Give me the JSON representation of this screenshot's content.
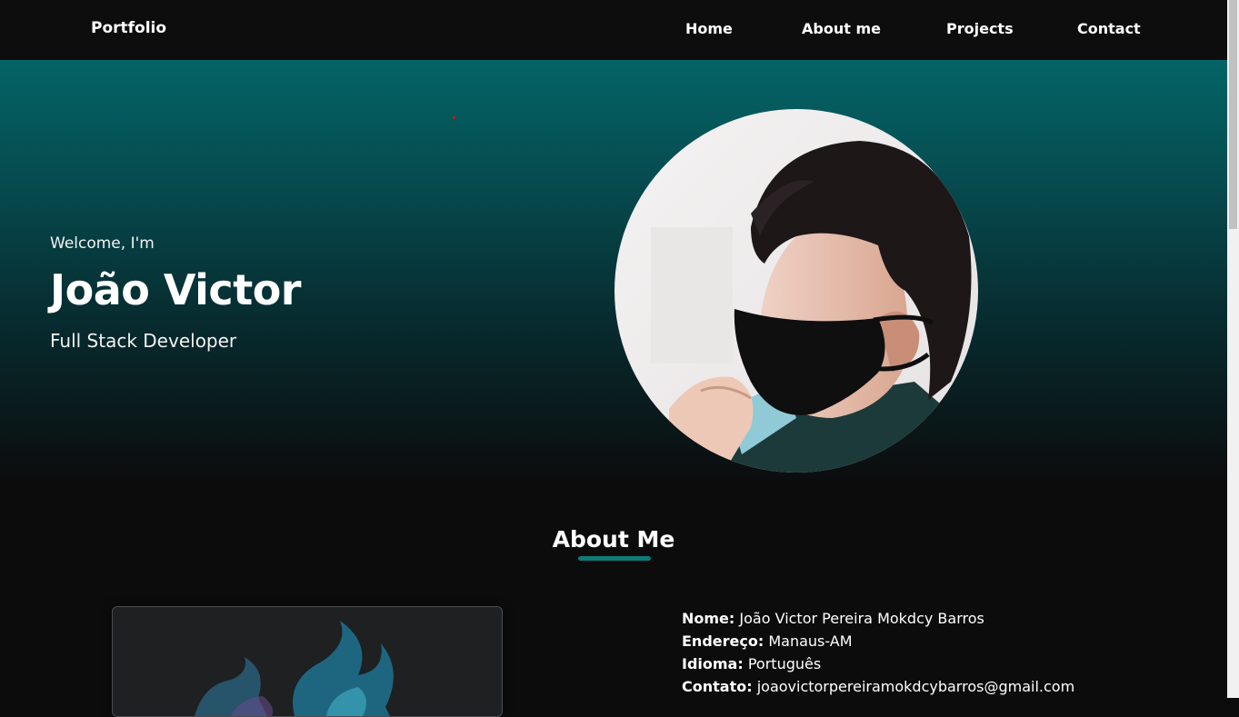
{
  "navbar": {
    "brand": "Portfolio",
    "links": [
      "Home",
      "About me",
      "Projects",
      "Contact"
    ]
  },
  "hero": {
    "welcome": "Welcome, I'm",
    "name": "João Victor",
    "role": "Full Stack Developer"
  },
  "about": {
    "title": "About Me",
    "info": [
      {
        "label": "Nome:",
        "value": "João Victor Pereira Mokdcy Barros"
      },
      {
        "label": "Endereço:",
        "value": "Manaus-AM"
      },
      {
        "label": "Idioma:",
        "value": "Português"
      },
      {
        "label": "Contato:",
        "value": "joaovictorpereiramokdcybarros@gmail.com"
      }
    ]
  },
  "colors": {
    "background": "#0c0c0d",
    "hero_teal": "#046466",
    "accent": "#0c7b78"
  }
}
